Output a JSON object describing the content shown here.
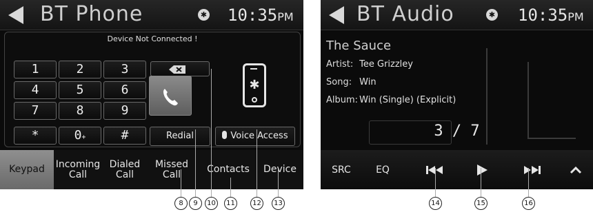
{
  "left_screen": {
    "title": "BT Phone",
    "bt_icon": "bluetooth-icon",
    "clock": "10:35",
    "clock_suffix": "PM",
    "status": "Device Not Connected !",
    "keypad": [
      {
        "main": "1",
        "sub": ""
      },
      {
        "main": "2",
        "sub": ""
      },
      {
        "main": "3",
        "sub": ""
      },
      {
        "main": "4",
        "sub": ""
      },
      {
        "main": "5",
        "sub": ""
      },
      {
        "main": "6",
        "sub": ""
      },
      {
        "main": "7",
        "sub": ""
      },
      {
        "main": "8",
        "sub": ""
      },
      {
        "main": "9",
        "sub": ""
      },
      {
        "main": "*",
        "sub": ""
      },
      {
        "main": "0",
        "sub": "+"
      },
      {
        "main": "#",
        "sub": ""
      }
    ],
    "redial_label": "Redial",
    "voice_label": "Voice Access",
    "tabs": [
      "Keypad",
      "Incoming Call",
      "Dialed Call",
      "Missed Call",
      "Contacts",
      "Device"
    ],
    "active_tab": "Keypad"
  },
  "right_screen": {
    "title": "BT Audio",
    "bt_icon": "bluetooth-icon",
    "clock": "10:35",
    "clock_suffix": "PM",
    "song_title": "The Sauce",
    "artist_label": "Artist:",
    "artist": "Tee Grizzley",
    "song_label": "Song:",
    "song": "Win",
    "album_label": "Album:",
    "album": "Win (Single) (Explicit)",
    "track": "3 / 7",
    "src_label": "SRC",
    "eq_label": "EQ"
  },
  "callouts": [
    "8",
    "9",
    "10",
    "11",
    "12",
    "13",
    "14",
    "15",
    "16"
  ],
  "colors": {
    "screen_bg": "#0b0b0b",
    "active_tab": "#8f8f8f",
    "text": "#e6e6e6"
  }
}
